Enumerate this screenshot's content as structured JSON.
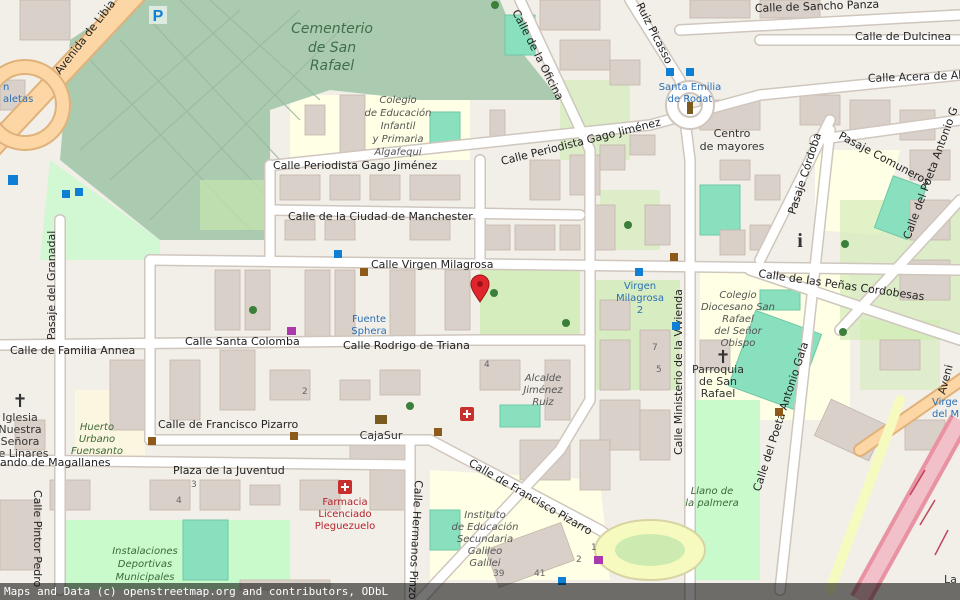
{
  "map": {
    "streets": {
      "avenida_libia": "Avenida de Libia",
      "calle_oficina": "Calle de la Oficina",
      "calle_ruiz_picasso": "Ruiz Picasso",
      "calle_sancho_panza": "Calle de Sancho Panza",
      "calle_dulcinea": "Calle de Dulcinea",
      "calle_acera_alo": "Calle Acera de Alo",
      "calle_periodista_1": "Calle Periodista Gago Jiménez",
      "calle_periodista_2": "Calle Periodista Gago Jiménez",
      "pasaje_cordoba": "Pasaje Córdoba",
      "pasaje_comuneros": "Pasaje Comuneros",
      "calle_poeta_antonio": "Calle del Poeta Antonio G",
      "calle_manchester": "Calle de la Ciudad de Manchester",
      "calle_virgen_milagrosa": "Calle Virgen Milagrosa",
      "calle_penas_cordobesas": "Calle de las Peñas Cordobesas",
      "pasaje_granadal": "Pasaje del Granadal",
      "calle_familia_annea": "Calle de Familia Annea",
      "calle_santa_colomba": "Calle Santa Colomba",
      "calle_rodrigo_triana": "Calle Rodrigo de Triana",
      "calle_ministerio_vivienda": "Calle Ministerio de la Vivienda",
      "calle_poeta_antonio_gala": "Calle del Poeta Antonio Gala",
      "calle_francisco_pizarro_1": "Calle de Francisco Pizarro",
      "calle_francisco_pizarro_2": "Calle de Francisco Pizarro",
      "plaza_juventud": "Plaza de la Juventud",
      "hernando_magallanes": "ando de Magallanes",
      "calle_pintor_pedro": "Calle Pintor Pedro",
      "calle_hermanos_pinzones": "Calle Hermanos Pinzones",
      "avenida_right": "Aveni"
    },
    "places": {
      "cementerio_line1": "Cementerio",
      "cementerio_line2": "de San",
      "cementerio_line3": "Rafael",
      "colegio_line1": "Colegio",
      "colegio_line2": "de Educación",
      "colegio_line3": "Infantil",
      "colegio_line4": "y Primaria",
      "colegio_line5": "Algafequi",
      "centro_line1": "Centro",
      "centro_line2": "de mayores",
      "santa_emilia_line1": "Santa Emilia",
      "santa_emilia_line2": "de Rodat",
      "fuente_line1": "Fuente",
      "fuente_line2": "Sphera",
      "virgen_line1": "Virgen",
      "virgen_line2": "Milagrosa",
      "virgen_line3": "2",
      "colegio_diocesano_line1": "Colegio",
      "colegio_diocesano_line2": "Diocesano San",
      "colegio_diocesano_line3": "Rafael",
      "colegio_diocesano_line4": "del Señor",
      "colegio_diocesano_line5": "Obispo",
      "parroquia_line1": "Parroquia",
      "parroquia_line2": "de San",
      "parroquia_line3": "Rafael",
      "alcalde_line1": "Alcalde",
      "alcalde_line2": "Jiménez",
      "alcalde_line3": "Ruiz",
      "iglesia_line1": "Iglesia",
      "iglesia_line2": "Nuestra",
      "iglesia_line3": "Señora",
      "iglesia_line4": "de Linares",
      "huerto_line1": "Huerto",
      "huerto_line2": "Urbano",
      "huerto_line3": "Fuensanto",
      "cajasur": "CajaSur",
      "farmacia_line1": "Farmacia",
      "farmacia_line2": "Licenciado",
      "farmacia_line3": "Pleguezuelo",
      "instituto_line1": "Instituto",
      "instituto_line2": "de Educación",
      "instituto_line3": "Secundaria",
      "instituto_line4": "Galileo",
      "instituto_line5": "Galilei",
      "instalaciones_line1": "Instalaciones",
      "instalaciones_line2": "Deportivas",
      "instalaciones_line3": "Municipales",
      "llano_line1": "Llano de",
      "llano_line2": "la palmera",
      "caletas_line1": "n",
      "caletas_line2": "aletas",
      "virgen_right_line1": "Virge",
      "virgen_right_line2": "del M",
      "la_right": "La"
    },
    "house_numbers": {
      "n7": "7",
      "n5": "5",
      "n4a": "4",
      "n2": "2",
      "n3": "3",
      "n4b": "4",
      "n1": "1",
      "n39": "39",
      "n41": "41",
      "n2b": "2"
    },
    "icons": {
      "parking": "P",
      "info": "i",
      "church": "✝",
      "marker_color": "#e0262c"
    },
    "colors": {
      "road_major": "#fcd6a4",
      "road_minor": "#ffffff",
      "park": "#c8facc",
      "cemetery": "#aacbaf",
      "school": "#ffffe5",
      "pitch": "#88e0be",
      "building": "#d9d0c9",
      "rail": "#e892a2"
    }
  },
  "attribution": "Maps and Data (c) openstreetmap.org and contributors, ODbL"
}
